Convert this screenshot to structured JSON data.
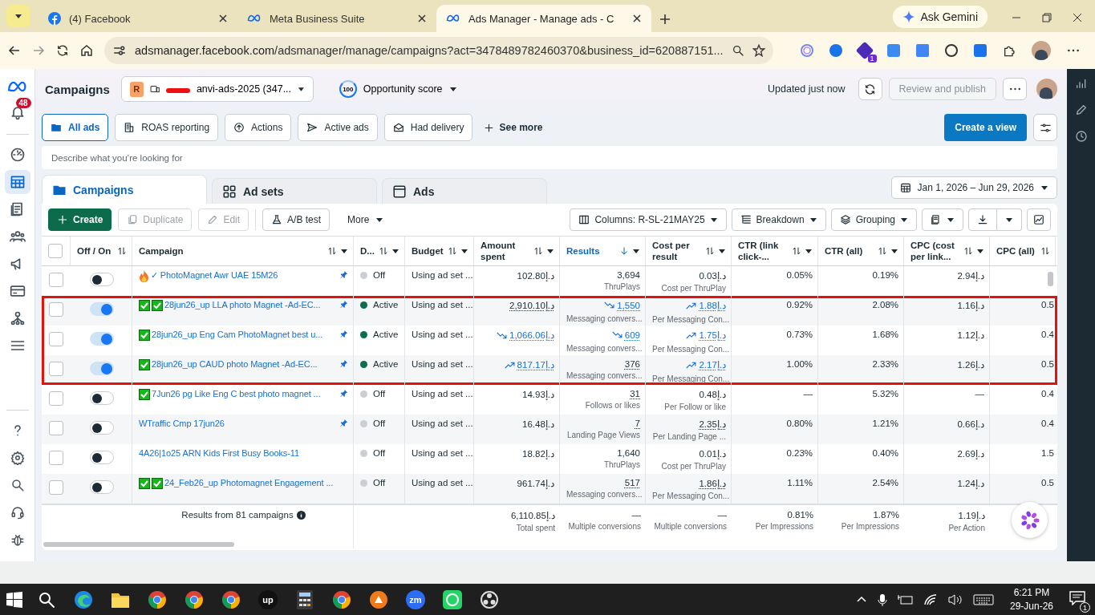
{
  "browser": {
    "tabs": [
      {
        "title": "(4) Facebook",
        "kind": "facebook",
        "selected": false
      },
      {
        "title": "Meta Business Suite",
        "kind": "meta",
        "selected": false
      },
      {
        "title": "Ads Manager - Manage ads - C",
        "kind": "meta",
        "selected": true
      }
    ],
    "gemini": "Ask Gemini",
    "url_host": "adsmanager.facebook.com",
    "url_path": "/adsmanager/manage/campaigns?act=3478489782460370&business_id=620887151...",
    "extension_badge": "1"
  },
  "header": {
    "title": "Campaigns",
    "account_initial": "R",
    "account_name": "anvi-ads-2025 (347...",
    "score": "100",
    "score_label": "Opportunity score",
    "updated": "Updated just now",
    "publish": "Review and publish"
  },
  "sidebar": {
    "notifications": "48",
    "items": [
      {
        "kind": "gauge",
        "selected": false
      },
      {
        "kind": "table",
        "selected": true
      },
      {
        "kind": "pages",
        "selected": false
      },
      {
        "kind": "people",
        "selected": false
      },
      {
        "kind": "megaphone",
        "selected": false
      },
      {
        "kind": "card",
        "selected": false
      },
      {
        "kind": "network",
        "selected": false
      },
      {
        "kind": "menu",
        "selected": false
      }
    ],
    "bottom": [
      {
        "kind": "help"
      },
      {
        "kind": "settings"
      },
      {
        "kind": "search"
      },
      {
        "kind": "headset"
      },
      {
        "kind": "bug"
      }
    ]
  },
  "views": [
    {
      "label": "All ads",
      "kind": "folder",
      "selected": true
    },
    {
      "label": "ROAS reporting",
      "kind": "coins",
      "selected": false
    },
    {
      "label": "Actions",
      "kind": "upload",
      "selected": false
    },
    {
      "label": "Active ads",
      "kind": "send",
      "selected": false
    },
    {
      "label": "Had delivery",
      "kind": "mail",
      "selected": false
    }
  ],
  "see_more": "See more",
  "create_view": "Create a view",
  "search": {
    "placeholder": "Describe what you’re looking for"
  },
  "level_tabs": [
    {
      "label": "Campaigns",
      "kind": "folder",
      "selected": true
    },
    {
      "label": "Ad sets",
      "kind": "grid",
      "selected": false
    },
    {
      "label": "Ads",
      "kind": "window",
      "selected": false
    }
  ],
  "date_range": "Jan 1, 2026 – Jun 29, 2026",
  "actions": [
    {
      "label": "Create",
      "kind": "create",
      "disabled": false
    },
    {
      "label": "Duplicate",
      "kind": "duplicate",
      "disabled": true
    },
    {
      "label": "Edit",
      "kind": "edit",
      "disabled": true
    },
    {
      "label": "A/B test",
      "kind": "flask",
      "disabled": false
    }
  ],
  "more": "More",
  "tools": [
    {
      "label": "Columns: R-SL-21MAY25",
      "kind": "columns"
    },
    {
      "label": "Breakdown",
      "kind": "breakdown"
    },
    {
      "label": "Grouping",
      "kind": "layers"
    }
  ],
  "table": {
    "all_checked": false,
    "columns": [
      {
        "label": "Off / On",
        "sorted": false
      },
      {
        "label": "Campaign",
        "sorted": false
      },
      {
        "label": "D...",
        "sorted": false
      },
      {
        "label": "Budget",
        "sorted": false
      },
      {
        "label": "Amount spent",
        "sorted": false
      },
      {
        "label": "Results",
        "sorted": true
      },
      {
        "label": "Cost per result",
        "sorted": false
      },
      {
        "label": "CTR (link click-...",
        "sorted": false
      },
      {
        "label": "CTR (all)",
        "sorted": false
      },
      {
        "label": "CPC (cost per link...",
        "sorted": false
      },
      {
        "label": "CPC (all)",
        "sorted": false
      }
    ],
    "rows": [
      {
        "checked": false,
        "on": false,
        "highlighted": false,
        "badges": [
          {
            "kind": "fire"
          }
        ],
        "name": "✓ PhotoMagnet Awr UAE 15M26",
        "pinned": true,
        "delivery": "Off",
        "color": "#cbcfd4",
        "budget": "Using ad set ...",
        "amount": {
          "value": "102.80د.إ",
          "underlined": false,
          "rising": false,
          "falling": false
        },
        "results": {
          "value": "3,694",
          "sub": "ThruPlays",
          "underlined": false,
          "rising": false,
          "falling": false
        },
        "cost": {
          "value": "0.03د.إ",
          "sub": "Cost per ThruPlay",
          "underlined": false,
          "rising": false,
          "falling": false
        },
        "ctr_link": "0.05%",
        "ctr_all": "0.19%",
        "cpc_link": "2.94د.إ"
      },
      {
        "checked": false,
        "on": true,
        "highlighted": true,
        "badges": [
          {
            "kind": "check"
          },
          {
            "kind": "check"
          }
        ],
        "name": "28jun26_up LLA photo Magnet -Ad-EC...",
        "pinned": true,
        "delivery": "Active",
        "color": "#0b6e4f",
        "budget": "Using ad set ...",
        "amount": {
          "value": "2,910.10د.إ",
          "underlined": true,
          "rising": false,
          "falling": false
        },
        "results": {
          "value": "1,550",
          "sub": "Messaging convers...",
          "underlined": true,
          "rising": false,
          "falling": true
        },
        "cost": {
          "value": "1.88د.إ",
          "sub": "Per Messaging Con...",
          "underlined": true,
          "rising": true,
          "falling": false
        },
        "ctr_link": "0.92%",
        "ctr_all": "2.08%",
        "cpc_link": "1.16د.إ",
        "cpc_all": "0.5"
      },
      {
        "checked": false,
        "on": true,
        "highlighted": true,
        "badges": [
          {
            "kind": "check"
          }
        ],
        "name": "28jun26_up Eng Cam PhotoMagnet best u...",
        "pinned": true,
        "delivery": "Active",
        "color": "#0b6e4f",
        "budget": "Using ad set ...",
        "amount": {
          "value": "1,066.06د.إ",
          "underlined": true,
          "rising": false,
          "falling": true
        },
        "results": {
          "value": "609",
          "sub": "Messaging convers...",
          "underlined": true,
          "rising": false,
          "falling": true
        },
        "cost": {
          "value": "1.75د.إ",
          "sub": "Per Messaging Con...",
          "underlined": true,
          "rising": true,
          "falling": false
        },
        "ctr_link": "0.73%",
        "ctr_all": "1.68%",
        "cpc_link": "1.12د.إ",
        "cpc_all": "0.4"
      },
      {
        "checked": false,
        "on": true,
        "highlighted": true,
        "badges": [
          {
            "kind": "check"
          }
        ],
        "name": "28jun26_up CAUD photo Magnet -Ad-EC...",
        "pinned": true,
        "delivery": "Active",
        "color": "#0b6e4f",
        "budget": "Using ad set ...",
        "amount": {
          "value": "817.17د.إ",
          "underlined": true,
          "rising": true,
          "falling": false
        },
        "results": {
          "value": "376",
          "sub": "Messaging convers...",
          "underlined": true,
          "rising": false,
          "falling": false
        },
        "cost": {
          "value": "2.17د.إ",
          "sub": "Per Messaging Con...",
          "underlined": true,
          "rising": true,
          "falling": false
        },
        "ctr_link": "1.00%",
        "ctr_all": "2.33%",
        "cpc_link": "1.26د.إ",
        "cpc_all": "0.5"
      },
      {
        "checked": false,
        "on": false,
        "highlighted": false,
        "badges": [
          {
            "kind": "check"
          }
        ],
        "name": "7Jun26 pg Like Eng C best photo magnet ...",
        "pinned": true,
        "delivery": "Off",
        "color": "#cbcfd4",
        "budget": "Using ad set ...",
        "amount": {
          "value": "14.93د.إ",
          "underlined": false,
          "rising": false,
          "falling": false
        },
        "results": {
          "value": "31",
          "sub": "Follows or likes",
          "underlined": true,
          "rising": false,
          "falling": false
        },
        "cost": {
          "value": "0.48د.إ",
          "sub": "Per Follow or like",
          "underlined": false,
          "rising": false,
          "falling": false
        },
        "ctr_link": "—",
        "ctr_all": "5.32%",
        "cpc_link": "—",
        "cpc_all": "0.4"
      },
      {
        "checked": false,
        "on": false,
        "highlighted": false,
        "badges": [],
        "name": "WTraffic Cmp 17jun26",
        "pinned": true,
        "delivery": "Off",
        "color": "#cbcfd4",
        "budget": "Using ad set ...",
        "amount": {
          "value": "16.48د.إ",
          "underlined": false,
          "rising": false,
          "falling": false
        },
        "results": {
          "value": "7",
          "sub": "Landing Page Views",
          "underlined": true,
          "rising": false,
          "falling": false
        },
        "cost": {
          "value": "2.35د.إ",
          "sub": "Per Landing Page ...",
          "underlined": true,
          "rising": false,
          "falling": false
        },
        "ctr_link": "0.80%",
        "ctr_all": "1.21%",
        "cpc_link": "0.66د.إ",
        "cpc_all": "0.4"
      },
      {
        "checked": false,
        "on": false,
        "highlighted": false,
        "badges": [],
        "name": "4A26|1o25 ARN Kids First Busy Books-11",
        "pinned": false,
        "delivery": "Off",
        "color": "#cbcfd4",
        "budget": "Using ad set ...",
        "amount": {
          "value": "18.82د.إ",
          "underlined": false,
          "rising": false,
          "falling": false
        },
        "results": {
          "value": "1,640",
          "sub": "ThruPlays",
          "underlined": false,
          "rising": false,
          "falling": false
        },
        "cost": {
          "value": "0.01د.إ",
          "sub": "Cost per ThruPlay",
          "underlined": false,
          "rising": false,
          "falling": false
        },
        "ctr_link": "0.23%",
        "ctr_all": "0.40%",
        "cpc_link": "2.69د.إ",
        "cpc_all": "1.5"
      },
      {
        "checked": false,
        "on": false,
        "highlighted": false,
        "badges": [
          {
            "kind": "check"
          },
          {
            "kind": "check"
          }
        ],
        "name": "24_Feb26_up Photomagnet Engagement ...",
        "pinned": false,
        "delivery": "Off",
        "color": "#cbcfd4",
        "budget": "Using ad set ...",
        "amount": {
          "value": "961.74د.إ",
          "underlined": false,
          "rising": false,
          "falling": false
        },
        "results": {
          "value": "517",
          "sub": "Messaging convers...",
          "underlined": true,
          "rising": false,
          "falling": false
        },
        "cost": {
          "value": "1.86د.إ",
          "sub": "Per Messaging Con...",
          "underlined": true,
          "rising": false,
          "falling": false
        },
        "ctr_link": "1.11%",
        "ctr_all": "2.54%",
        "cpc_link": "1.24د.إ",
        "cpc_all": "0.5"
      }
    ],
    "summary": {
      "label": "Results from 81 campaigns",
      "cells": [
        {
          "value": "6,110.85د.إ",
          "sub": "Total spent"
        },
        {
          "value": "—",
          "sub": "Multiple conversions"
        },
        {
          "value": "—",
          "sub": "Multiple conversions"
        },
        {
          "value": "0.81%",
          "sub": "Per Impressions"
        },
        {
          "value": "1.87%",
          "sub": "Per Impressions"
        },
        {
          "value": "1.19د.إ",
          "sub": "Per Action"
        }
      ]
    }
  },
  "taskbar": {
    "apps": [
      {
        "kind": "search"
      },
      {
        "kind": "edge"
      },
      {
        "kind": "folder"
      },
      {
        "kind": "chrome"
      },
      {
        "kind": "chrome"
      },
      {
        "kind": "chrome"
      },
      {
        "kind": "badge",
        "label": "up",
        "color": "#111111"
      },
      {
        "kind": "calculator"
      },
      {
        "kind": "chrome"
      },
      {
        "kind": "orange"
      },
      {
        "kind": "badge",
        "label": "zm",
        "color": "#2d6df6"
      },
      {
        "kind": "whatsapp"
      },
      {
        "kind": "obs"
      }
    ],
    "time": "6:21 PM",
    "date": "29-Jun-26",
    "notification_count": "1"
  }
}
